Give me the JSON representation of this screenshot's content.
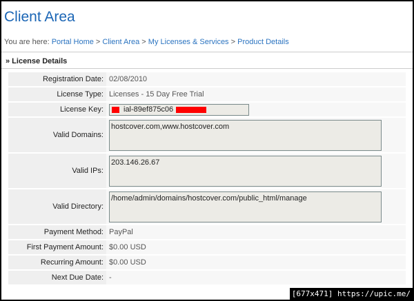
{
  "page": {
    "title": "Client Area"
  },
  "breadcrumb": {
    "prefix": "You are here:",
    "items": [
      "Portal Home",
      "Client Area",
      "My Licenses & Services",
      "Product Details"
    ],
    "separator": ">"
  },
  "section": {
    "heading": "» License Details"
  },
  "details": {
    "registration_date": {
      "label": "Registration Date:",
      "value": "02/08/2010"
    },
    "license_type": {
      "label": "License Type:",
      "value": "Licenses - 15 Day Free Trial"
    },
    "license_key": {
      "label": "License Key:",
      "value": "ial-89ef875c06"
    },
    "valid_domains": {
      "label": "Valid Domains:",
      "value": "hostcover.com,www.hostcover.com"
    },
    "valid_ips": {
      "label": "Valid IPs:",
      "value": "203.146.26.67"
    },
    "valid_directory": {
      "label": "Valid Directory:",
      "value": "/home/admin/domains/hostcover.com/public_html/manage"
    },
    "payment_method": {
      "label": "Payment Method:",
      "value": "PayPal"
    },
    "first_payment": {
      "label": "First Payment Amount:",
      "value": "$0.00 USD"
    },
    "recurring": {
      "label": "Recurring Amount:",
      "value": "$0.00 USD"
    },
    "next_due": {
      "label": "Next Due Date:",
      "value": "-"
    }
  },
  "credit": {
    "text": "[677x471] https://upic.me/"
  },
  "colors": {
    "title": "#1a65b5",
    "link": "#2a73c0",
    "redaction": "#ff0000"
  }
}
